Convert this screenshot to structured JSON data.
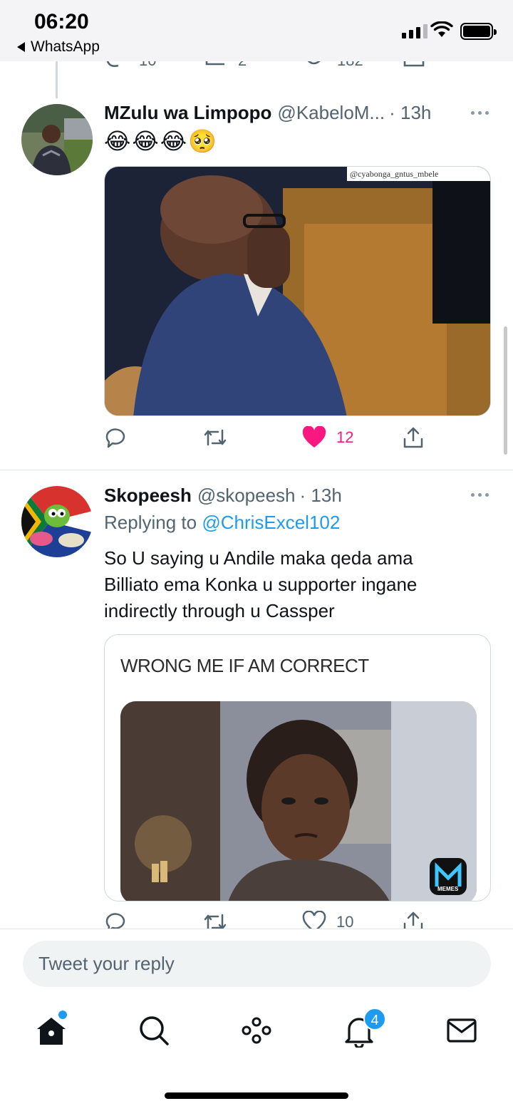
{
  "status_bar": {
    "time": "06:20",
    "back_app": "WhatsApp"
  },
  "ghost_actions": {
    "replies": "10",
    "retweets": "2",
    "likes": "182"
  },
  "tweets": [
    {
      "name": "MZulu wa Limpopo",
      "handle": "@KabeloM...",
      "time": "· 13h",
      "emoji": "😂😂😂🥺",
      "media_watermark": "@cyabonga_gntus_mbele",
      "likes": "12"
    },
    {
      "name": "Skopeesh",
      "handle": "@skopeesh",
      "time": "· 13h",
      "replying_prefix": "Replying to ",
      "replying_handle": "@ChrisExcel102",
      "text": "So U saying u Andile maka qeda ama Billiato ema Konka u supporter ingane indirectly through u Cassper",
      "meme_caption": "WRONG ME IF AM CORRECT",
      "meme_logo": "MEMES",
      "likes": "10"
    }
  ],
  "composer": {
    "placeholder": "Tweet your reply"
  },
  "tabbar": {
    "notifications_badge": "4"
  },
  "colors": {
    "accent": "#1d9bf0",
    "like": "#f91880",
    "muted": "#536471"
  }
}
